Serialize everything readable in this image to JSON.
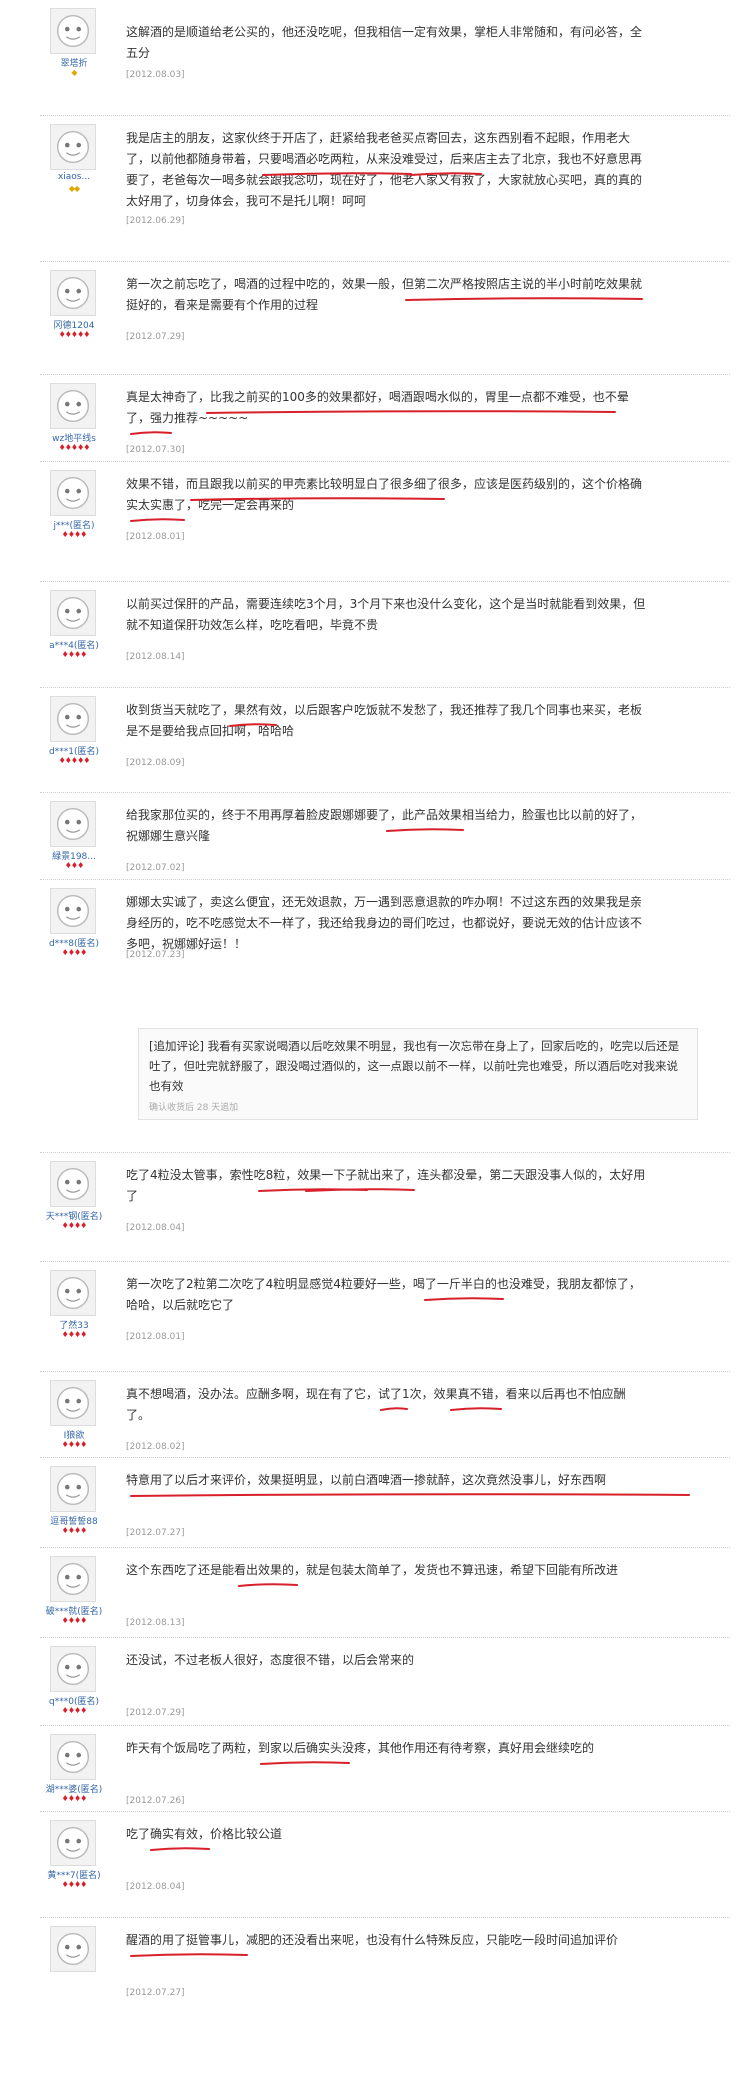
{
  "reviews": [
    {
      "user": "翠塔折",
      "badge": "◆",
      "badge_color": "gold",
      "text": "这解酒的是顺道给老公买的，他还没吃呢，但我相信一定有效果，掌柜人非常随和，有问必答，全五分",
      "date": "[2012.08.03]"
    },
    {
      "user": "xiaos...",
      "badge": "◆◆",
      "badge_color": "gold",
      "text": "我是店主的朋友，这家伙终于开店了，赶紧给我老爸买点寄回去，这东西别看不起眼，作用老大了，以前他都随身带着，只要喝酒必吃两粒，从来没难受过，后来店主去了北京，我也不好意思再要了，老爸每次一喝多就会跟我念叨，现在好了，他老人家又有救了，大家就放心买吧，真的真的太好用了，切身体会，我可不是托儿啊！呵呵",
      "date": "[2012.06.29]"
    },
    {
      "user": "冈德1204",
      "badge": "♦♦♦♦♦",
      "badge_color": "red",
      "text": "第一次之前忘吃了，喝酒的过程中吃的，效果一般，但第二次严格按照店主说的半小时前吃效果就挺好的，看来是需要有个作用的过程",
      "date": "[2012.07.29]"
    },
    {
      "user": "wz地平线s",
      "badge": "♦♦♦♦♦",
      "badge_color": "red",
      "text": "真是太神奇了，比我之前买的100多的效果都好，喝酒跟喝水似的，胃里一点都不难受，也不晕了，强力推荐~~~~~",
      "date": "[2012.07.30]"
    },
    {
      "user": "j***(匿名)",
      "badge": "♦♦♦♦",
      "badge_color": "red",
      "text": "效果不错，而且跟我以前买的甲壳素比较明显白了很多细了很多，应该是医药级别的，这个价格确实太实惠了，吃完一定会再来的",
      "date": "[2012.08.01]"
    },
    {
      "user": "a***4(匿名)",
      "badge": "♦♦♦♦",
      "badge_color": "red",
      "text": "以前买过保肝的产品，需要连续吃3个月，3个月下来也没什么变化，这个是当时就能看到效果，但就不知道保肝功效怎么样，吃吃看吧，毕竟不贵",
      "date": "[2012.08.14]"
    },
    {
      "user": "d***1(匿名)",
      "badge": "♦♦♦♦♦",
      "badge_color": "red",
      "text": "收到货当天就吃了，果然有效，以后跟客户吃饭就不发愁了，我还推荐了我几个同事也来买，老板是不是要给我点回扣啊，哈哈哈",
      "date": "[2012.08.09]"
    },
    {
      "user": "緑景198...",
      "badge": "♦♦♦",
      "badge_color": "red",
      "text": "给我家那位买的，终于不用再厚着脸皮跟娜娜要了，此产品效果相当给力，脸蛋也比以前的好了，祝娜娜生意兴隆",
      "date": "[2012.07.02]"
    },
    {
      "user": "d***8(匿名)",
      "badge": "♦♦♦♦",
      "badge_color": "red",
      "text": "娜娜太实诚了，卖这么便宜，还无效退款，万一遇到恶意退款的咋办啊！不过这东西的效果我是亲身经历的，吃不吃感觉太不一样了，我还给我身边的哥们吃过，也都说好，要说无效的估计应该不多吧，祝娜娜好运！！",
      "date": "[2012.07.23]",
      "append": {
        "text": "[追加评论] 我看有买家说喝酒以后吃效果不明显，我也有一次忘带在身上了，回家后吃的，吃完以后还是吐了，但吐完就舒服了，跟没喝过酒似的，这一点跟以前不一样，以前吐完也难受，所以酒后吃对我来说也有效",
        "note": "确认收货后 28 天追加"
      }
    },
    {
      "user": "天***钢(匿名)",
      "badge": "♦♦♦♦",
      "badge_color": "red",
      "text": "吃了4粒没太管事，索性吃8粒，效果一下子就出来了，连头都没晕，第二天跟没事人似的，太好用了",
      "date": "[2012.08.04]"
    },
    {
      "user": "了然33",
      "badge": "♦♦♦♦",
      "badge_color": "red",
      "text": "第一次吃了2粒第二次吃了4粒明显感觉4粒要好一些，喝了一斤半白的也没难受，我朋友都惊了，哈哈，以后就吃它了",
      "date": "[2012.08.01]"
    },
    {
      "user": "I狼欲",
      "badge": "♦♦♦♦",
      "badge_color": "red",
      "text": "真不想喝酒，没办法。应酬多啊，现在有了它，试了1次，效果真不错，看来以后再也不怕应酬了。",
      "date": "[2012.08.02]"
    },
    {
      "user": "逗哥誓誓88",
      "badge": "♦♦♦♦",
      "badge_color": "red",
      "text": "特意用了以后才来评价，效果挺明显，以前白酒啤酒一掺就醉，这次竟然没事儿，好东西啊",
      "date": "[2012.07.27]"
    },
    {
      "user": "破***就(匿名)",
      "badge": "♦♦♦♦",
      "badge_color": "red",
      "text": "这个东西吃了还是能看出效果的，就是包装太简单了，发货也不算迅速，希望下回能有所改进",
      "date": "[2012.08.13]"
    },
    {
      "user": "q***0(匿名)",
      "badge": "♦♦♦♦",
      "badge_color": "red",
      "text": "还没试，不过老板人很好，态度很不错，以后会常来的",
      "date": "[2012.07.29]"
    },
    {
      "user": "湖***婆(匿名)",
      "badge": "♦♦♦♦",
      "badge_color": "red",
      "text": "昨天有个饭局吃了两粒，到家以后确实头没疼，其他作用还有待考察，真好用会继续吃的",
      "date": "[2012.07.26]"
    },
    {
      "user": "黄***7(匿名)",
      "badge": "♦♦♦♦",
      "badge_color": "red",
      "text": "吃了确实有效，价格比较公道",
      "date": "[2012.08.04]"
    },
    {
      "user": "",
      "badge": "",
      "badge_color": "red",
      "text": "醒酒的用了挺管事儿，减肥的还没看出来呢，也没有什么特殊反应，只能吃一段时间追加评价",
      "date": "[2012.07.27]"
    }
  ]
}
